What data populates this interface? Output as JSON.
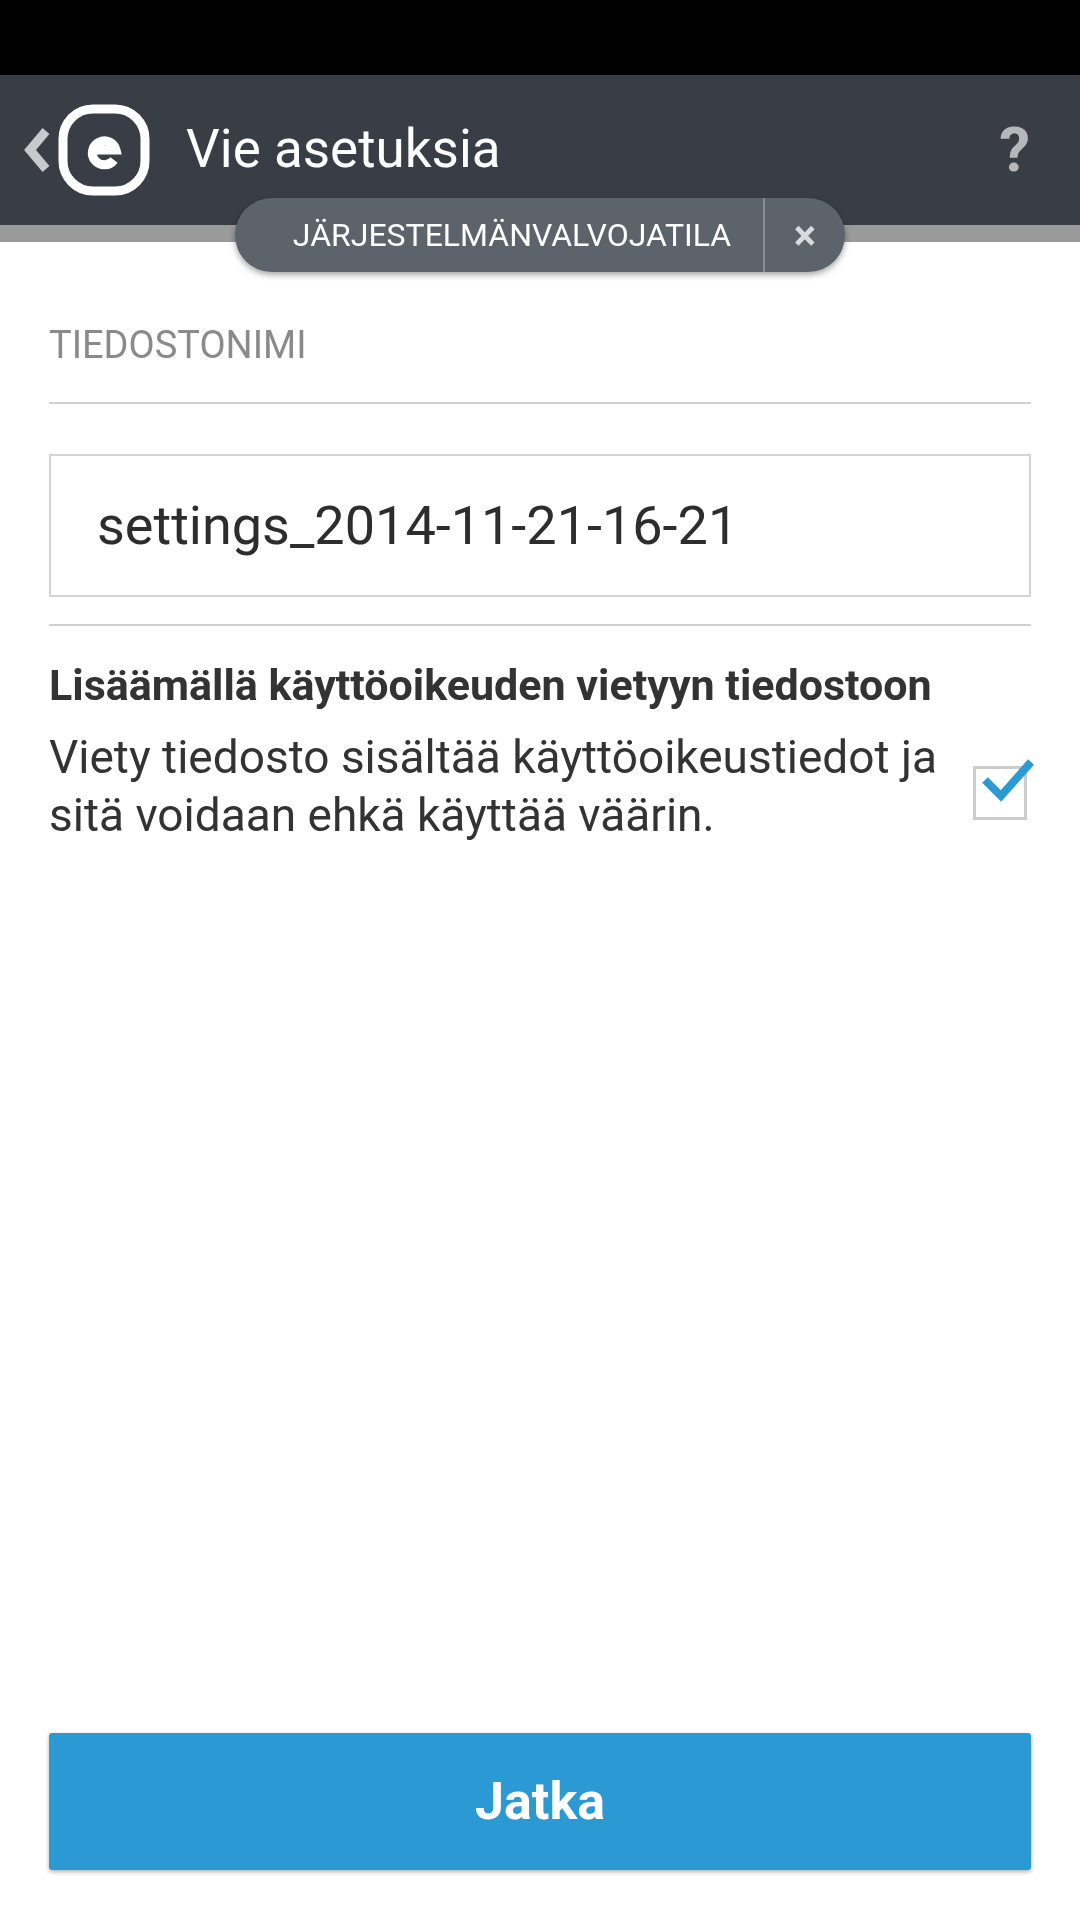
{
  "header": {
    "title": "Vie asetuksia"
  },
  "admin_mode": {
    "label": "JÄRJESTELMÄNVALVOJATILA",
    "close": "×"
  },
  "help": "?",
  "filename": {
    "label": "TIEDOSTONIMI",
    "value": "settings_2014-11-21-16-21"
  },
  "option": {
    "title": "Lisäämällä käyttöoikeuden vietyyn tiedostoon",
    "description": "Viety tiedosto sisältää käyttöoikeustiedot ja sitä voidaan ehkä käyttää väärin.",
    "checked": true
  },
  "continue_button": "Jatka"
}
